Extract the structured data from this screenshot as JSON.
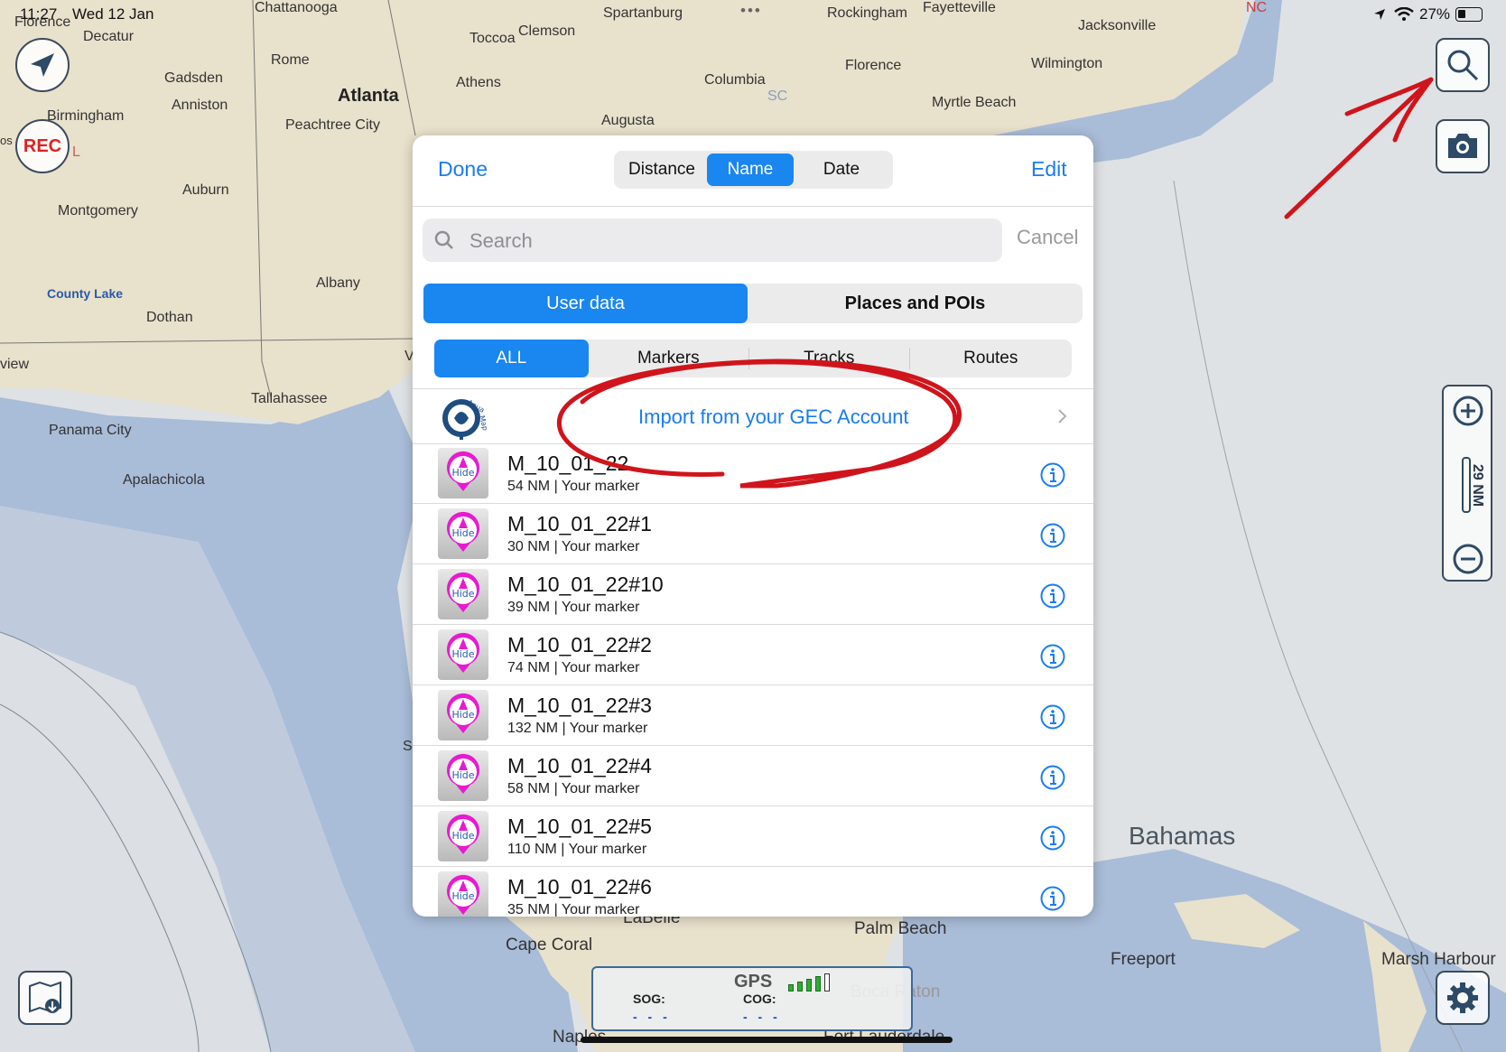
{
  "status_bar": {
    "time": "11:27",
    "date": "Wed 12 Jan",
    "battery": "27%"
  },
  "map": {
    "labels": [
      "Florence",
      "Decatur",
      "Chattanooga",
      "Rome",
      "Gadsden",
      "Anniston",
      "Birmingham",
      "Atlanta",
      "Peachtree City",
      "Auburn",
      "Montgomery",
      "County Lake",
      "Dothan",
      "Albany",
      "Tallahassee",
      "Panama City",
      "Apalachicola",
      "Toccoa",
      "Clemson",
      "Spartanburg",
      "Athens",
      "Augusta",
      "Columbia",
      "SC",
      "Rockingham",
      "Fayetteville",
      "Florence",
      "Jacksonville",
      "Wilmington",
      "Myrtle Beach",
      "NC",
      "view",
      "os",
      "L",
      "V",
      "S",
      "Bahamas",
      "Palm Beach",
      "Freeport",
      "Marsh Harbour",
      "Cape Coral",
      "LaBelle",
      "Boca Raton",
      "Fort Lauderdale",
      "Naples"
    ],
    "rec_label": "REC",
    "scale_label": "29 NM"
  },
  "gps_panel": {
    "gps_label": "GPS",
    "sog_label": "SOG:",
    "cog_label": "COG:",
    "sog_value": "- - -",
    "cog_value": "- - -",
    "signal_bars": 4
  },
  "modal": {
    "done_label": "Done",
    "edit_label": "Edit",
    "sort_options": [
      "Distance",
      "Name",
      "Date"
    ],
    "sort_selected": "Name",
    "search_placeholder": "Search",
    "cancel_label": "Cancel",
    "source_tabs": [
      "User data",
      "Places and POIs"
    ],
    "source_selected": "User data",
    "filter_tabs": [
      "ALL",
      "Markers",
      "Tracks",
      "Routes"
    ],
    "filter_selected": "ALL",
    "import_label": "Import from your GEC Account",
    "logo_text": "Aqua Map",
    "marker_badge": "Hide",
    "items": [
      {
        "name": "M_10_01_22",
        "detail": "54 NM | Your marker"
      },
      {
        "name": "M_10_01_22#1",
        "detail": "30 NM | Your marker"
      },
      {
        "name": "M_10_01_22#10",
        "detail": "39 NM | Your marker"
      },
      {
        "name": "M_10_01_22#2",
        "detail": "74 NM | Your marker"
      },
      {
        "name": "M_10_01_22#3",
        "detail": "132 NM | Your marker"
      },
      {
        "name": "M_10_01_22#4",
        "detail": "58 NM | Your marker"
      },
      {
        "name": "M_10_01_22#5",
        "detail": "110 NM | Your marker"
      },
      {
        "name": "M_10_01_22#6",
        "detail": "35 NM | Your marker"
      }
    ]
  },
  "colors": {
    "accent": "#1a86f0",
    "annotation": "#d0141c",
    "land": "#e9e3cf",
    "water": "#a9bbd6",
    "marker_pink": "#e81ad0"
  }
}
